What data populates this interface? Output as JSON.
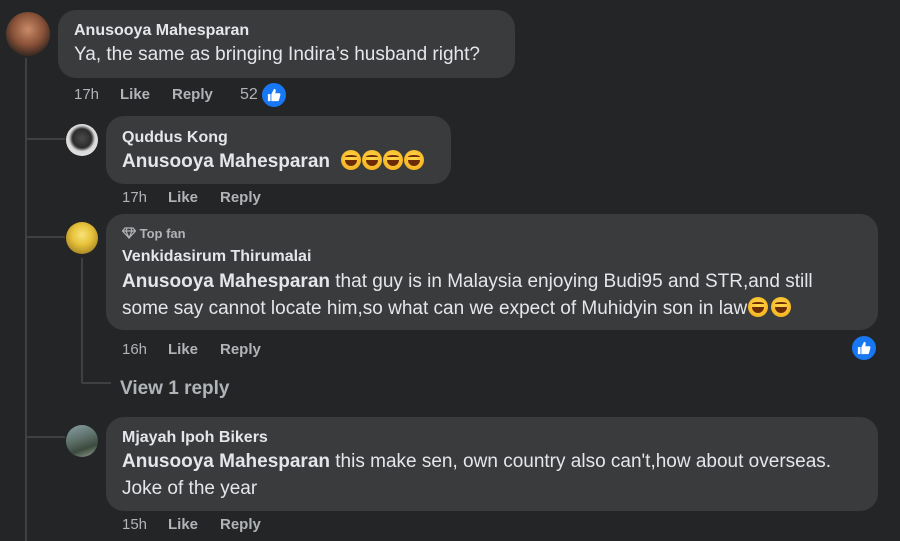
{
  "comments": [
    {
      "author": "Anusooya Mahesparan",
      "text": "Ya, the same as bringing Indira’s husband right?",
      "time": "17h",
      "like_label": "Like",
      "reply_label": "Reply",
      "reaction_count": "52"
    },
    {
      "author": "Quddus Kong",
      "mention": "Anusooya Mahesparan",
      "time": "17h",
      "like_label": "Like",
      "reply_label": "Reply",
      "emojis": [
        "joy",
        "sweat-smile",
        "joy",
        "joy"
      ]
    },
    {
      "badge": "Top fan",
      "author": "Venkidasirum Thirumalai",
      "mention": "Anusooya Mahesparan",
      "text_line1": " that guy is in Malaysia enjoying Budi95 and STR,and still",
      "text_line2": "some say cannot locate him,so what can we expect of Muhidyin son in law",
      "time": "16h",
      "like_label": "Like",
      "reply_label": "Reply",
      "view_replies": "View 1 reply",
      "emojis": [
        "grin",
        "grin"
      ]
    },
    {
      "author": "Mjayah Ipoh Bikers",
      "mention": "Anusooya Mahesparan",
      "text_line1": " this make sen, own country also can't,how about overseas.",
      "text_line2": "Joke of the year",
      "time": "15h",
      "like_label": "Like",
      "reply_label": "Reply"
    }
  ],
  "colors": {
    "background": "#242526",
    "bubble": "#3a3b3c",
    "text": "#e4e6eb",
    "meta": "#b0b3b8",
    "like_blue": "#1877f2",
    "thread_line": "#3e4042"
  },
  "icons": [
    "thumbs-up-icon",
    "diamond-icon",
    "emoji-icon"
  ]
}
